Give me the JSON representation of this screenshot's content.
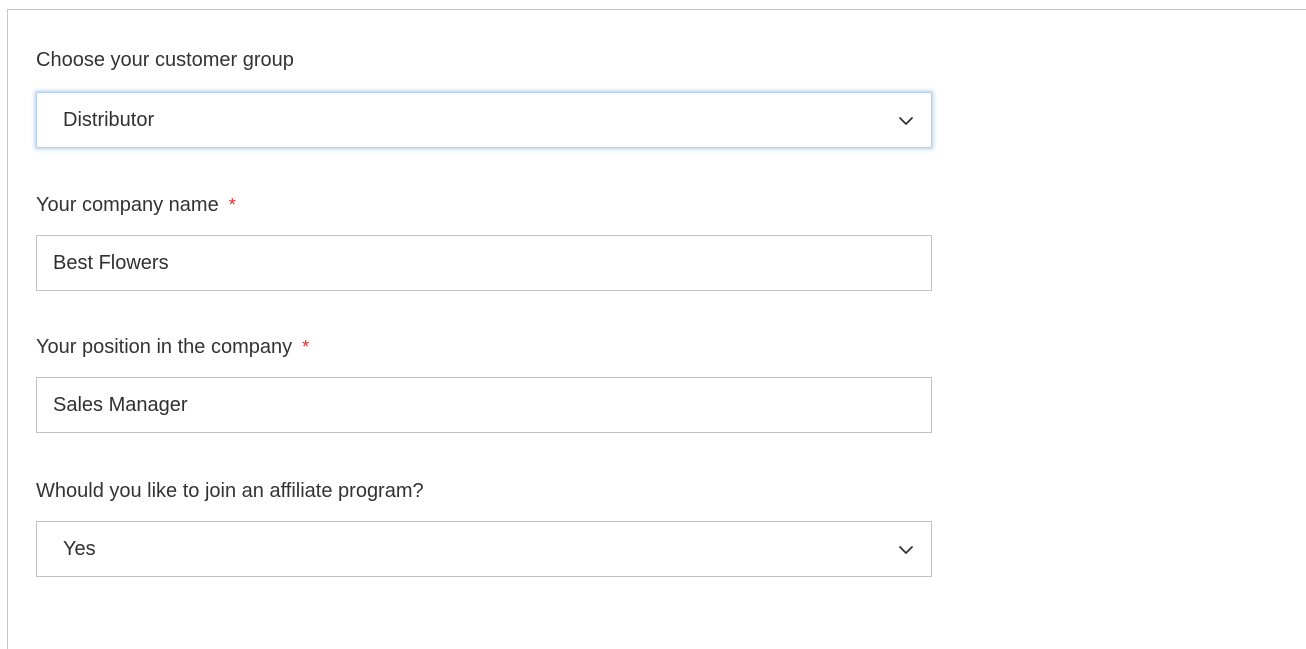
{
  "form": {
    "customer_group": {
      "label": "Choose your customer group",
      "selected": "Distributor"
    },
    "company_name": {
      "label": "Your company name",
      "required_mark": "*",
      "value": "Best Flowers"
    },
    "position": {
      "label": "Your position in the company",
      "required_mark": "*",
      "value": "Sales Manager"
    },
    "affiliate": {
      "label": "Whould you like to join an affiliate program?",
      "selected": "Yes"
    }
  },
  "icons": {
    "select_arrow": "chevron-down-icon"
  },
  "colors": {
    "required": "#e02b27",
    "focus_glow": "#6aa0d7",
    "border": "#c2c2c2",
    "text": "#333333"
  }
}
